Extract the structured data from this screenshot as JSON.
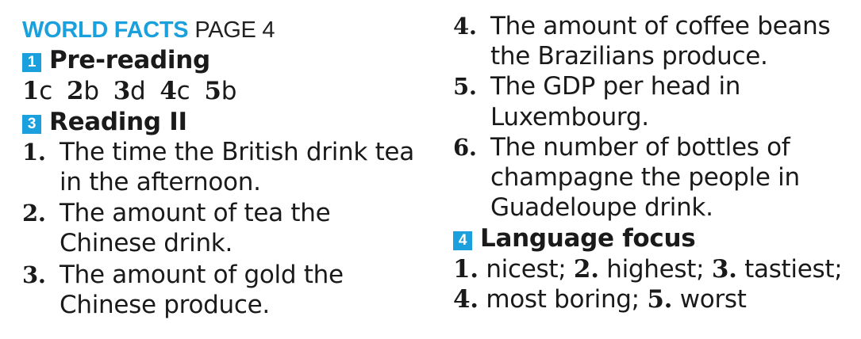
{
  "header": {
    "title": "WORLD FACTS",
    "page": "PAGE 4"
  },
  "pre_reading": {
    "badge": "1",
    "heading": "Pre-reading",
    "answers": [
      {
        "n": "1",
        "a": "c"
      },
      {
        "n": "2",
        "a": "b"
      },
      {
        "n": "3",
        "a": "d"
      },
      {
        "n": "4",
        "a": "c"
      },
      {
        "n": "5",
        "a": "b"
      }
    ]
  },
  "reading2": {
    "badge": "3",
    "heading": "Reading II",
    "items": [
      {
        "num": "1.",
        "lines": [
          "The time the British drink tea",
          "in the afternoon."
        ]
      },
      {
        "num": "2.",
        "lines": [
          "The amount of tea the",
          "Chinese drink."
        ]
      },
      {
        "num": "3.",
        "lines": [
          "The amount of gold the",
          "Chinese produce."
        ]
      },
      {
        "num": "4.",
        "lines": [
          "The amount of coffee beans",
          "the Brazilians produce."
        ]
      },
      {
        "num": "5.",
        "lines": [
          "The GDP per head in",
          "Luxembourg."
        ]
      },
      {
        "num": "6.",
        "lines": [
          "The number of bottles of",
          "champagne the people in",
          "Guadeloupe drink."
        ]
      }
    ]
  },
  "language_focus": {
    "badge": "4",
    "heading": "Language focus",
    "answers": [
      {
        "num": "1.",
        "text": "nicest;"
      },
      {
        "num": "2.",
        "text": "highest;"
      },
      {
        "num": "3.",
        "text": "tastiest;"
      },
      {
        "num": "4.",
        "text": "most boring;"
      },
      {
        "num": "5.",
        "text": "worst"
      }
    ]
  },
  "colors": {
    "accent": "#1aa0dc",
    "text": "#1a1a1a"
  }
}
